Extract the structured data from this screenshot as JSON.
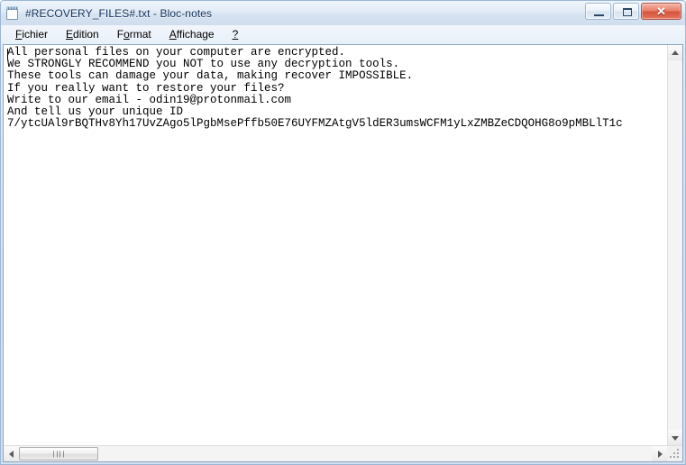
{
  "window": {
    "title": "#RECOVERY_FILES#.txt - Bloc-notes",
    "icon": "notepad-icon",
    "controls": {
      "minimize_label": "–",
      "maximize_label": "□",
      "close_label": "✕"
    }
  },
  "menubar": {
    "items": [
      {
        "label": "Fichier",
        "accel": "F"
      },
      {
        "label": "Edition",
        "accel": "E"
      },
      {
        "label": "Format",
        "accel": "o"
      },
      {
        "label": "Affichage",
        "accel": "A"
      },
      {
        "label": "?",
        "accel": "?"
      }
    ]
  },
  "document": {
    "lines": [
      "All personal files on your computer are encrypted.",
      "We STRONGLY RECOMMEND you NOT to use any decryption tools.",
      "These tools can damage your data, making recover IMPOSSIBLE.",
      "If you really want to restore your files?",
      "Write to our email - odin19@protonmail.com",
      "And tell us your unique ID",
      "7/ytcUAl9rBQTHv8Yh17UvZAgo5lPgbMsePffb50E76UYFMZAtgV5ldER3umsWCFM1yLxZMBZeCDQOHG8o9pMBLlT1c"
    ],
    "text": "All personal files on your computer are encrypted.\nWe STRONGLY RECOMMEND you NOT to use any decryption tools.\nThese tools can damage your data, making recover IMPOSSIBLE.\nIf you really want to restore your files?\nWrite to our email - odin19@protonmail.com\nAnd tell us your unique ID\n7/ytcUAl9rBQTHv8Yh17UvZAgo5lPgbMsePffb50E76UYFMZAtgV5ldER3umsWCFM1yLxZMBZeCDQOHG8o9pMBLlT1c",
    "email": "odin19@protonmail.com",
    "unique_id": "7/ytcUAl9rBQTHv8Yh17UvZAgo5lPgbMsePffb50E76UYFMZAtgV5ldER3umsWCFM1yLxZMBZeCDQOHG8o9pMBLlT1c"
  },
  "scrollbars": {
    "vertical": {
      "up_arrow": "scroll-up-arrow",
      "down_arrow": "scroll-down-arrow"
    },
    "horizontal": {
      "left_arrow": "scroll-left-arrow",
      "right_arrow": "scroll-right-arrow"
    }
  },
  "colors": {
    "titlebar_text": "#13325c",
    "close_button": "#d6543c",
    "window_border": "#9cb6d4",
    "client_background": "#ffffff",
    "text": "#000000"
  }
}
